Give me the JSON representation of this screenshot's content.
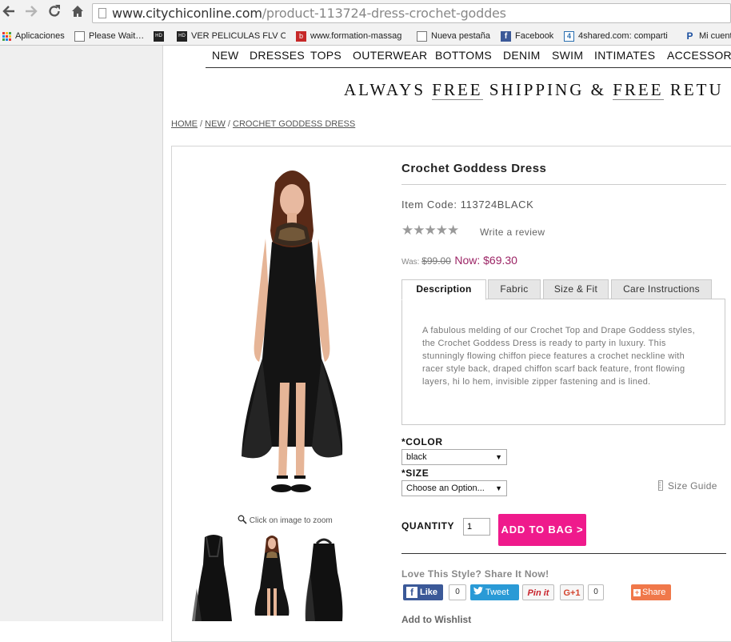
{
  "browser": {
    "url_domain": "www.citychiconline.com",
    "url_path": "/product-113724-dress-crochet-goddes",
    "bookmarks": [
      {
        "label": "Aplicaciones",
        "icon": "apps-grid-icon"
      },
      {
        "label": "Please Wait…",
        "icon": "page-icon"
      },
      {
        "label": "",
        "icon": "hd-icon"
      },
      {
        "label": "VER PELICULAS FLV ONL",
        "icon": "hd-icon"
      },
      {
        "label": "www.formation-massag",
        "icon": "bookmark-red-icon"
      },
      {
        "label": "Nueva pestaña",
        "icon": "page-icon"
      },
      {
        "label": "Facebook",
        "icon": "facebook-icon"
      },
      {
        "label": "4shared.com: comparti",
        "icon": "4shared-icon"
      },
      {
        "label": "Mi cuent",
        "icon": "paypal-icon"
      }
    ]
  },
  "nav": {
    "items": [
      "NEW",
      "DRESSES",
      "TOPS",
      "OUTERWEAR",
      "BOTTOMS",
      "DENIM",
      "SWIM",
      "INTIMATES",
      "ACCESSORI"
    ]
  },
  "promo": {
    "part1": "ALWAYS ",
    "free1": "FREE",
    "part2": " SHIPPING & ",
    "free2": "FREE",
    "part3": " RETU"
  },
  "breadcrumb": {
    "home": "HOME",
    "sep": " / ",
    "new": "NEW",
    "current": "CROCHET GODDESS DRESS"
  },
  "product": {
    "title": "Crochet Goddess Dress",
    "item_code": "Item Code: 113724BLACK",
    "stars": "★★★★★",
    "write_review": "Write a review",
    "was_label": "Was: ",
    "was_price": "$99.00",
    "now_label": "Now: ",
    "now_price": "$69.30",
    "zoom_hint": "Click on image to zoom",
    "tabs": [
      "Description",
      "Fabric",
      "Size & Fit",
      "Care Instructions"
    ],
    "description": "A fabulous melding of our Crochet Top and Drape Goddess styles, the Crochet Goddess Dress is ready to party in luxury. This stunningly flowing chiffon piece features a crochet neckline with racer style back, draped chiffon scarf back feature, front flowing layers, hi lo hem, invisible zipper fastening and is lined.",
    "color_label": "*COLOR",
    "color_value": "black",
    "size_label": "*SIZE",
    "size_value": "Choose an Option...",
    "size_guide": "Size Guide",
    "quantity_label": "QUANTITY",
    "quantity_value": "1",
    "add_to_bag": "ADD TO BAG >",
    "share_heading": "Love This Style? Share It Now!",
    "share": {
      "like": "Like",
      "like_count": "0",
      "tweet": "Tweet",
      "pinit": "Pin it",
      "gplus": "G+1",
      "gplus_count": "0",
      "share": "Share"
    },
    "wishlist": "Add to Wishlist"
  },
  "colors": {
    "accent_pink": "#ef1a8c",
    "price_now": "#9c2465",
    "facebook": "#3b5998",
    "twitter": "#2a9ad6",
    "share_orange": "#f0784a"
  }
}
